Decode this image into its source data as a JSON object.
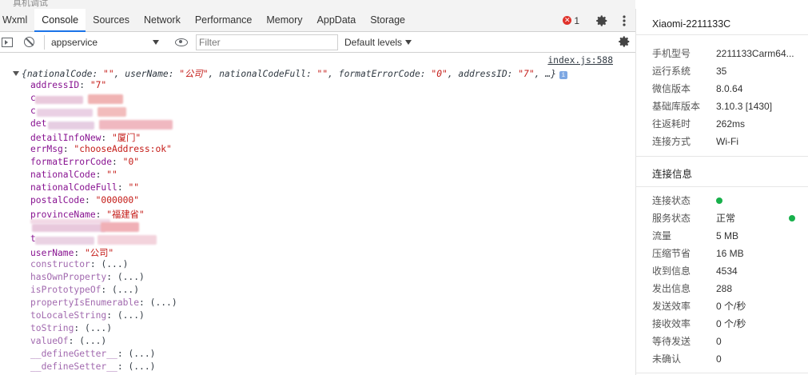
{
  "window": {
    "title": "真机调试"
  },
  "tabs": [
    {
      "label": "Wxml",
      "active": false
    },
    {
      "label": "Console",
      "active": true
    },
    {
      "label": "Sources",
      "active": false
    },
    {
      "label": "Network",
      "active": false
    },
    {
      "label": "Performance",
      "active": false
    },
    {
      "label": "Memory",
      "active": false
    },
    {
      "label": "AppData",
      "active": false
    },
    {
      "label": "Storage",
      "active": false
    }
  ],
  "errors": {
    "count": "1",
    "icon": "error-icon"
  },
  "toolbar": {
    "context": "appservice",
    "filter_placeholder": "Filter",
    "levels": "Default levels"
  },
  "console": {
    "source_link": "index.js:588",
    "summary": {
      "k1": "nationalCode",
      "v1": "\"\"",
      "k2": "userName",
      "v2": "\"公司\"",
      "k3": "nationalCodeFull",
      "v3": "\"\"",
      "k4": "formatErrorCode",
      "v4": "\"0\"",
      "k5": "addressID",
      "v5": "\"7\"",
      "tail": "…}"
    },
    "props": [
      {
        "key": "addressID",
        "value": "\"7\""
      },
      {
        "key": "c",
        "value": ""
      },
      {
        "key": "c",
        "value": ""
      },
      {
        "key": "det",
        "value": ""
      },
      {
        "key": "detailInfoNew",
        "value": "\"厦门\""
      },
      {
        "key": "errMsg",
        "value": "\"chooseAddress:ok\""
      },
      {
        "key": "formatErrorCode",
        "value": "\"0\""
      },
      {
        "key": "nationalCode",
        "value": "\"\""
      },
      {
        "key": "nationalCodeFull",
        "value": "\"\""
      },
      {
        "key": "postalCode",
        "value": "\"000000\""
      },
      {
        "key": "provinceName",
        "value": "\"福建省\""
      },
      {
        "key": "",
        "value": ""
      },
      {
        "key": "t",
        "value": ""
      },
      {
        "key": "userName",
        "value": "\"公司\""
      }
    ],
    "proto": [
      {
        "key": "constructor",
        "value": "(...)"
      },
      {
        "key": "hasOwnProperty",
        "value": "(...)"
      },
      {
        "key": "isPrototypeOf",
        "value": "(...)"
      },
      {
        "key": "propertyIsEnumerable",
        "value": "(...)"
      },
      {
        "key": "toLocaleString",
        "value": "(...)"
      },
      {
        "key": "toString",
        "value": "(...)"
      },
      {
        "key": "valueOf",
        "value": "(...)"
      },
      {
        "key": "__defineGetter__",
        "value": "(...)"
      },
      {
        "key": "__defineSetter__",
        "value": "(...)"
      }
    ]
  },
  "device": {
    "title": "Xiaomi-2211133C",
    "info": [
      {
        "label": "手机型号",
        "value": "2211133Carm64..."
      },
      {
        "label": "运行系统",
        "value": "35"
      },
      {
        "label": "微信版本",
        "value": "8.0.64"
      },
      {
        "label": "基础库版本",
        "value": "3.10.3 [1430]"
      },
      {
        "label": "往返耗时",
        "value": "262ms"
      },
      {
        "label": "连接方式",
        "value": "Wi-Fi"
      }
    ]
  },
  "connection": {
    "title": "连接信息",
    "rows": [
      {
        "label": "连接状态",
        "value": ""
      },
      {
        "label": "服务状态",
        "value": "正常"
      },
      {
        "label": "流量",
        "value": "5 MB"
      },
      {
        "label": "压缩节省",
        "value": "16 MB"
      },
      {
        "label": "收到信息",
        "value": "4534"
      },
      {
        "label": "发出信息",
        "value": "288"
      },
      {
        "label": "发送效率",
        "value": "0 个/秒"
      },
      {
        "label": "接收效率",
        "value": "0 个/秒"
      },
      {
        "label": "等待发送",
        "value": "0"
      },
      {
        "label": "未确认",
        "value": "0"
      }
    ],
    "status_color": "#18b04b"
  },
  "colors": {
    "accent": "#1a73e8",
    "error": "#e0322b",
    "key": "#881391",
    "string": "#c41a16"
  }
}
